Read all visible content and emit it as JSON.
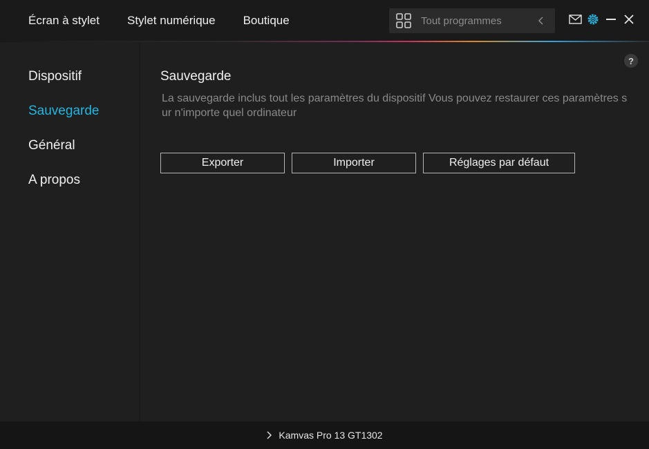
{
  "topnav": {
    "items": [
      {
        "label": "Écran à stylet"
      },
      {
        "label": "Stylet numérique"
      },
      {
        "label": "Boutique"
      }
    ]
  },
  "search": {
    "placeholder": "Tout programmes",
    "icon": "grid-icon"
  },
  "window_controls": {
    "icons": [
      "mail-icon",
      "gear-icon",
      "minimize-icon",
      "close-icon"
    ]
  },
  "sidebar": {
    "items": [
      {
        "label": "Dispositif"
      },
      {
        "label": "Sauvegarde"
      },
      {
        "label": "Général"
      },
      {
        "label": "A propos"
      }
    ],
    "active_index": 1
  },
  "main": {
    "help_label": "?",
    "title": "Sauvegarde",
    "description": "La sauvegarde inclus tout les paramètres du dispositif Vous pouvez restaurer ces paramètres sur n'importe quel ordinateur",
    "buttons": {
      "export": "Exporter",
      "import": "Importer",
      "defaults": "Réglages par défaut"
    }
  },
  "statusbar": {
    "device": "Kamvas Pro 13 GT1302"
  },
  "colors": {
    "accent": "#24b5e0",
    "background": "#1f1f1f",
    "topbar": "#1a1a1a",
    "statusbar": "#151515"
  }
}
